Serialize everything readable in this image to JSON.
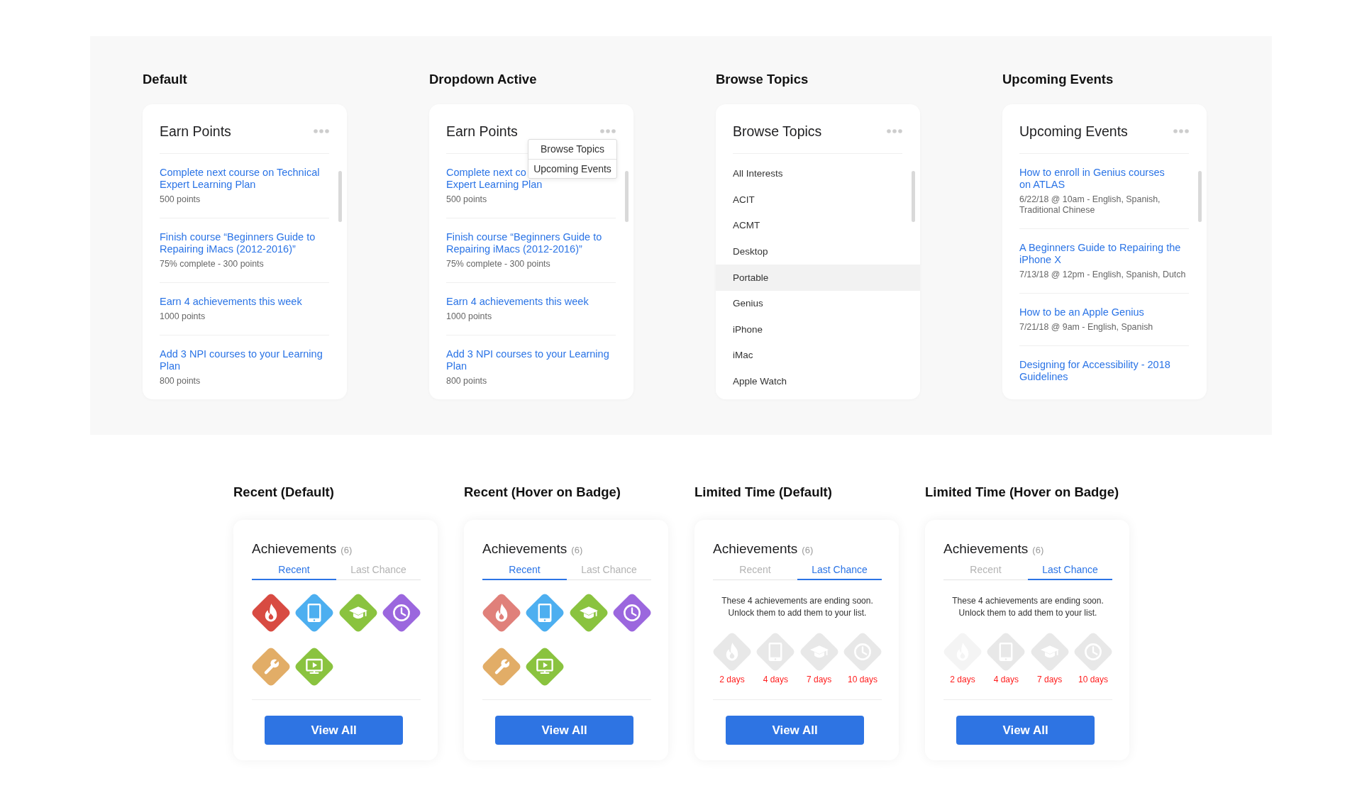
{
  "showcase": {
    "sections": [
      {
        "heading": "Default",
        "card": {
          "kind": "tasks",
          "title": "Earn Points",
          "items": [
            {
              "title_lines": [
                "Complete next course on Technical",
                "Expert Learning Plan"
              ],
              "meta": "500 points"
            },
            {
              "title_lines": [
                "Finish course “Beginners Guide to",
                "Repairing iMacs (2012-2016)”"
              ],
              "meta": "75% complete - 300 points"
            },
            {
              "title_lines": [
                "Earn 4 achievements this week"
              ],
              "meta": "1000 points"
            },
            {
              "title_lines": [
                "Add 3 NPI courses to your Learning",
                "Plan"
              ],
              "meta": "800 points"
            }
          ]
        }
      },
      {
        "heading": "Dropdown Active",
        "card": {
          "kind": "tasks",
          "title": "Earn Points",
          "menu": [
            "Browse Topics",
            "Upcoming Events"
          ],
          "items": [
            {
              "title_lines": [
                "Complete next co",
                "Expert Learning Plan"
              ],
              "meta": "500 points"
            },
            {
              "title_lines": [
                "Finish course “Beginners Guide to",
                "Repairing iMacs (2012-2016)”"
              ],
              "meta": "75% complete - 300 points"
            },
            {
              "title_lines": [
                "Earn 4 achievements this week"
              ],
              "meta": "1000 points"
            },
            {
              "title_lines": [
                "Add 3 NPI courses to your Learning",
                "Plan"
              ],
              "meta": "800 points"
            }
          ]
        }
      },
      {
        "heading": "Browse Topics",
        "card": {
          "kind": "topics",
          "title": "Browse Topics",
          "topics": [
            {
              "label": "All Interests",
              "selected": false
            },
            {
              "label": "ACIT",
              "selected": false
            },
            {
              "label": "ACMT",
              "selected": false
            },
            {
              "label": "Desktop",
              "selected": false
            },
            {
              "label": "Portable",
              "selected": true
            },
            {
              "label": "Genius",
              "selected": false
            },
            {
              "label": "iPhone",
              "selected": false
            },
            {
              "label": "iMac",
              "selected": false
            },
            {
              "label": "Apple Watch",
              "selected": false
            }
          ]
        }
      },
      {
        "heading": "Upcoming Events",
        "card": {
          "kind": "events",
          "title": "Upcoming Events",
          "items": [
            {
              "title_lines": [
                "How to enroll in Genius courses",
                "on ATLAS"
              ],
              "meta": "6/22/18 @ 10am - English, Spanish, Traditional Chinese"
            },
            {
              "title_lines": [
                "A Beginners Guide to Repairing the",
                "iPhone X"
              ],
              "meta": "7/13/18 @ 12pm - English, Spanish, Dutch"
            },
            {
              "title_lines": [
                "How to be an Apple Genius"
              ],
              "meta": "7/21/18 @ 9am - English, Spanish"
            },
            {
              "title_lines": [
                "Designing for Accessibility - 2018",
                "Guidelines"
              ]
            }
          ]
        }
      }
    ]
  },
  "achievements": {
    "sections": [
      {
        "heading": "Recent (Default)",
        "card": {
          "title": "Achievements",
          "count": "(6)",
          "tabs": [
            {
              "label": "Recent",
              "selected": true
            },
            {
              "label": "Last Chance",
              "selected": false
            }
          ],
          "badges": [
            {
              "kind": "flame",
              "color": "#d84b42"
            },
            {
              "kind": "tablet",
              "color": "#4daff0"
            },
            {
              "kind": "graduation-cap",
              "color": "#8ac33f"
            },
            {
              "kind": "clock",
              "color": "#9b67de"
            },
            {
              "kind": "wrench",
              "color": "#e2ad67"
            },
            {
              "kind": "monitor-play",
              "color": "#8ac33f"
            }
          ],
          "button": "View All"
        }
      },
      {
        "heading": "Recent (Hover on Badge)",
        "card": {
          "title": "Achievements",
          "count": "(6)",
          "tabs": [
            {
              "label": "Recent",
              "selected": true
            },
            {
              "label": "Last Chance",
              "selected": false
            }
          ],
          "badges": [
            {
              "kind": "flame",
              "color": "#e0807a"
            },
            {
              "kind": "tablet",
              "color": "#4daff0"
            },
            {
              "kind": "graduation-cap",
              "color": "#8ac33f"
            },
            {
              "kind": "clock",
              "color": "#9b67de"
            },
            {
              "kind": "wrench",
              "color": "#e2ad67"
            },
            {
              "kind": "monitor-play",
              "color": "#8ac33f"
            }
          ],
          "button": "View All"
        }
      },
      {
        "heading": "Limited Time (Default)",
        "card": {
          "title": "Achievements",
          "count": "(6)",
          "tabs": [
            {
              "label": "Recent",
              "selected": false
            },
            {
              "label": "Last Chance",
              "selected": true
            }
          ],
          "message": "These 4 achievements are ending soon. Unlock them to add them to your list.",
          "badges": [
            {
              "kind": "flame",
              "color": "#e8e8e8",
              "days_left": "2 days"
            },
            {
              "kind": "tablet",
              "color": "#e8e8e8",
              "days_left": "4 days"
            },
            {
              "kind": "graduation-cap",
              "color": "#e8e8e8",
              "days_left": "7 days"
            },
            {
              "kind": "clock",
              "color": "#e8e8e8",
              "days_left": "10 days"
            }
          ],
          "button": "View All"
        }
      },
      {
        "heading": "Limited Time (Hover on Badge)",
        "card": {
          "title": "Achievements",
          "count": "(6)",
          "tabs": [
            {
              "label": "Recent",
              "selected": false
            },
            {
              "label": "Last Chance",
              "selected": true
            }
          ],
          "message": "These 4 achievements are ending soon. Unlock them to add them to your list.",
          "badges": [
            {
              "kind": "flame",
              "color": "#f4f4f4",
              "days_left": "2 days"
            },
            {
              "kind": "tablet",
              "color": "#e8e8e8",
              "days_left": "4 days"
            },
            {
              "kind": "graduation-cap",
              "color": "#e8e8e8",
              "days_left": "7 days"
            },
            {
              "kind": "clock",
              "color": "#e8e8e8",
              "days_left": "10 days"
            }
          ],
          "button": "View All"
        }
      }
    ]
  }
}
